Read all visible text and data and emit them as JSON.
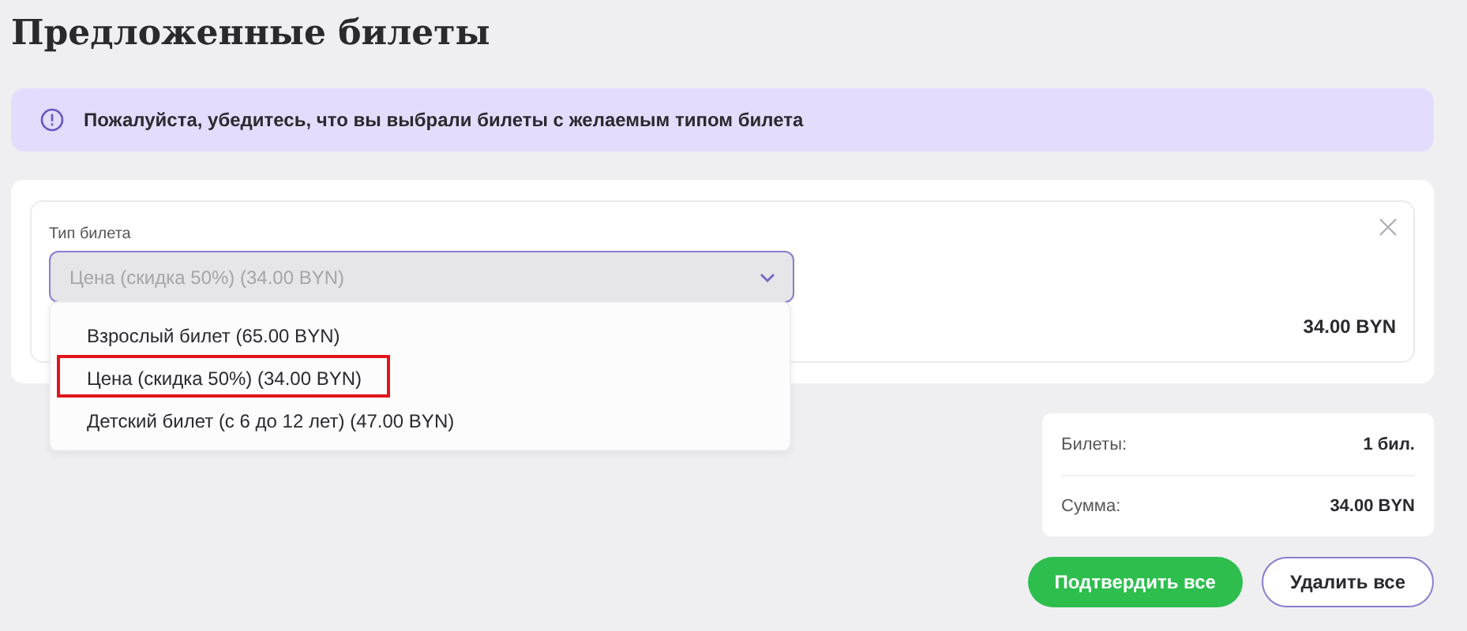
{
  "title": "Предложенные билеты",
  "notice": {
    "text": "Пожалуйста, убедитесь, что вы выбрали билеты с желаемым типом билета"
  },
  "ticket": {
    "label": "Тип билета",
    "value": "Цена (скидка 50%) (34.00 BYN)",
    "expanded": true,
    "price": "34.00 BYN",
    "options": [
      {
        "label": "Взрослый билет (65.00 BYN)",
        "highlighted": false
      },
      {
        "label": "Цена (скидка 50%) (34.00 BYN)",
        "highlighted": true
      },
      {
        "label": "Детский билет (с 6 до 12 лет) (47.00 BYN)",
        "highlighted": false
      }
    ]
  },
  "summary": [
    {
      "label": "Билеты:",
      "value": "1 бил."
    },
    {
      "label": "Сумма:",
      "value": "34.00 BYN"
    }
  ],
  "buttons": [
    {
      "label": "Подтвердить все",
      "kind": "primary"
    },
    {
      "label": "Удалить все",
      "kind": "outline"
    }
  ]
}
